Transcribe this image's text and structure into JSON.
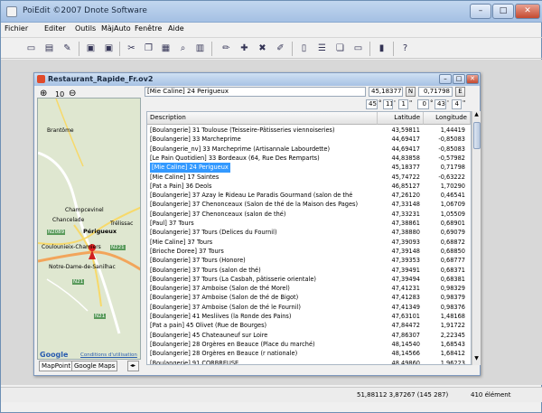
{
  "app": {
    "title": "PoiEdit ©2007 Dnote Software"
  },
  "window_controls": {
    "minimize": "–",
    "maximize": "□",
    "close": "✕"
  },
  "menu": [
    "Fichier",
    "Editer",
    "Outils",
    "MàjAuto",
    "Fenêtre",
    "Aide"
  ],
  "toolbar_icons": [
    "new-icon",
    "open-icon",
    "open-folder-icon",
    "save-icon",
    "save-as-icon",
    "cut-icon",
    "copy-icon",
    "paste-icon",
    "find-icon",
    "pencil-icon",
    "add-icon",
    "delete-icon",
    "edit-icon",
    "columns-icon",
    "rows-icon",
    "copy-window-icon",
    "window-icon",
    "device-icon",
    "help-icon"
  ],
  "child": {
    "title": "Restaurant_Rapide_Fr.ov2",
    "zoom_level": "10",
    "selected_name": "[Mie Caline] 24 Perigueux",
    "latitude_value": "45,18377",
    "latitude_dir": "N",
    "longitude_value": "0,71798",
    "longitude_dir": "E",
    "lat_deg": "45",
    "lat_min": "11",
    "lat_sec": "1",
    "lon_deg": "0",
    "lon_min": "43",
    "lon_sec": "4",
    "deg_mark": "°",
    "min_mark": "'",
    "sec_mark": "\""
  },
  "map": {
    "labels": [
      "Brantôme",
      "Champcevinel",
      "Chancelade",
      "Périgueux",
      "Trélissac",
      "N2089",
      "Coulounieix-Chamiers",
      "N221",
      "Notre-Dame-de-Sanilhac",
      "N21",
      "N21"
    ],
    "google": "Google",
    "terms": "Conditions d'utilisation",
    "tabs": [
      "MapPoint",
      "Google Maps"
    ]
  },
  "grid": {
    "columns": [
      "Description",
      "Latitude",
      "Longitude"
    ],
    "selected_index": 4,
    "rows": [
      [
        "[Boulangerie] 31 Toulouse (Teisseire-Pâtisseries viennoiseries)",
        "43,59811",
        "1,44419"
      ],
      [
        "[Boulangerie] 33 Marcheprime",
        "44,69417",
        "-0,85083"
      ],
      [
        "[Boulangerie_nv] 33 Marcheprime (Artisannale Labourdette)",
        "44,69417",
        "-0,85083"
      ],
      [
        "[Le Pain Quotidien] 33 Bordeaux (64, Rue Des Remparts)",
        "44,83858",
        "-0,57982"
      ],
      [
        "[Mie Caline] 24 Perigueux",
        "45,18377",
        "0,71798"
      ],
      [
        "[Mie Caline] 17 Saintes",
        "45,74722",
        "-0,63222"
      ],
      [
        "[Pat a Pain] 36 Deols",
        "46,85127",
        "1,70290"
      ],
      [
        "[Boulangerie] 37 Azay le Rideau Le Paradis Gourmand (salon de thé",
        "47,26120",
        "0,46541"
      ],
      [
        "[Boulangerie] 37 Chenonceaux (Salon de thé de la Maison des Pages)",
        "47,33148",
        "1,06709"
      ],
      [
        "[Boulangerie] 37 Chenonceaux (salon de thé)",
        "47,33231",
        "1,05509"
      ],
      [
        "[Paul] 37 Tours",
        "47,38861",
        "0,68901"
      ],
      [
        "[Boulangerie] 37 Tours (Delices du Fournil)",
        "47,38880",
        "0,69079"
      ],
      [
        "[Mie Caline] 37 Tours",
        "47,39093",
        "0,68872"
      ],
      [
        "[Brioche Doree] 37 Tours",
        "47,39148",
        "0,68850"
      ],
      [
        "[Boulangerie] 37 Tours (Honore)",
        "47,39353",
        "0,68777"
      ],
      [
        "[Boulangerie] 37 Tours (salon de thé)",
        "47,39491",
        "0,68371"
      ],
      [
        "[Boulangerie] 37 Tours (La Casbah, pâtisserie orientale)",
        "47,39494",
        "0,68381"
      ],
      [
        "[Boulangerie] 37 Amboise (Salon de thé Morel)",
        "47,41231",
        "0,98329"
      ],
      [
        "[Boulangerie] 37 Amboise (Salon de thé de Bigot)",
        "47,41283",
        "0,98379"
      ],
      [
        "[Boulangerie] 37 Amboise (Salon de thé le Fournil)",
        "47,41349",
        "0,98376"
      ],
      [
        "[Boulangerie] 41 Mesliives (la Ronde des Pains)",
        "47,63101",
        "1,48168"
      ],
      [
        "[Pat a pain] 45 Olivet (Rue de Bourges)",
        "47,84472",
        "1,91722"
      ],
      [
        "[Boulangerie] 45 Chateauneuf sur Loire",
        "47,86307",
        "2,22345"
      ],
      [
        "[Boulangerie] 28 Orgères en Beauce (Place du marché)",
        "48,14540",
        "1,68543"
      ],
      [
        "[Boulangerie] 28 Orgères en Beauce (r nationale)",
        "48,14566",
        "1,68412"
      ],
      [
        "[Boulangerie] 91 CORBREUSE",
        "48,49860",
        "1,96223"
      ]
    ]
  },
  "status": {
    "coords": "51,88112 3,87267 (145 287)",
    "count": "410 élément"
  }
}
